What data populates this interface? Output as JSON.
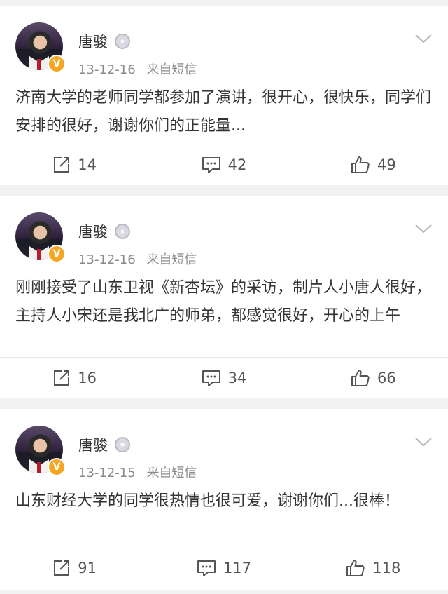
{
  "posts": [
    {
      "author": "唐骏",
      "date": "13-12-16",
      "source": "来自短信",
      "text": "济南大学的老师同学都参加了演讲，很开心，很快乐，同学们安排的很好，谢谢你们的正能量...",
      "reposts": "14",
      "comments": "42",
      "likes": "49"
    },
    {
      "author": "唐骏",
      "date": "13-12-16",
      "source": "来自短信",
      "text": "刚刚接受了山东卫视《新杏坛》的采访，制片人小唐人很好，主持人小宋还是我北广的师弟，都感觉很好，开心的上午",
      "reposts": "16",
      "comments": "34",
      "likes": "66"
    },
    {
      "author": "唐骏",
      "date": "13-12-15",
      "source": "来自短信",
      "text": "山东财经大学的同学很热情也很可爱，谢谢你们...很棒！",
      "reposts": "91",
      "comments": "117",
      "likes": "118"
    }
  ],
  "icons": {
    "verified": "verified-badge-icon",
    "medal": "medal-icon",
    "more": "chevron-down-icon",
    "repost": "repost-icon",
    "comment": "comment-icon",
    "like": "like-icon"
  },
  "colors": {
    "verified_badge": "#f5a623",
    "meta_text": "#8a8a8a",
    "background": "#f2f2f2"
  }
}
